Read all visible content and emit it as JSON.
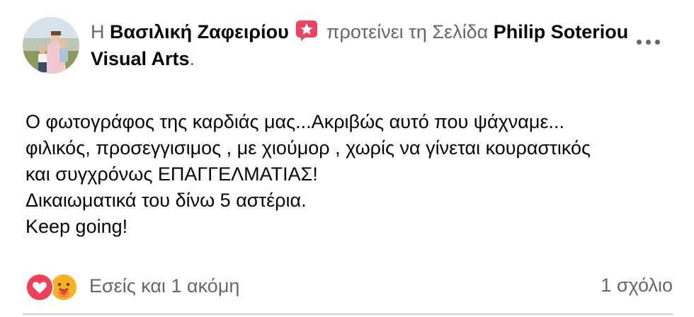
{
  "post": {
    "author": "Βασιλική Ζαφειρίου",
    "prefix": "Η",
    "action_text": "προτείνει τη Σελίδα",
    "page_name": "Philip Soteriou Visual Arts",
    "period": ".",
    "body_lines": [
      "Ο φωτογράφος της καρδιάς μας...Ακριβώς αυτό που ψάχναμε...",
      "φιλικός, προσεγγισιμος , με χιούμορ , χωρίς να γίνεται κουραστικός",
      "και συγχρόνως ΕΠΑΓΓΕΛΜΑΤΙΑΣ!",
      "Δικαιωματικά του δίνω 5 αστέρια.",
      "Keep going!"
    ]
  },
  "reactions": {
    "label": "Εσείς και 1 ακόμη",
    "icons": [
      "love-icon",
      "care-icon"
    ]
  },
  "comments": {
    "label": "1 σχόλιο"
  },
  "icons": {
    "recommend": "star-badge-icon",
    "menu": "more-options-icon"
  },
  "colors": {
    "recommend_badge": "#f3425f",
    "love": "#f33e58",
    "care": "#f7b125",
    "secondary_text": "#65676b",
    "primary_text": "#050505"
  }
}
